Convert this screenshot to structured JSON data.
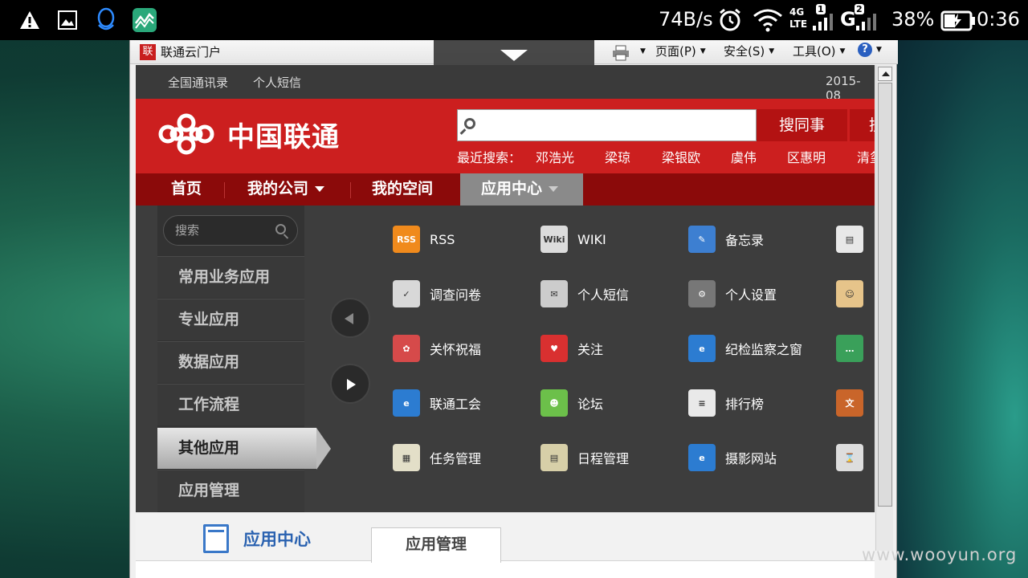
{
  "status_bar": {
    "net_speed": "74B/s",
    "net_type": "4G",
    "lte": "LTE",
    "sim1": "1",
    "sim2": "2",
    "g_label": "G",
    "battery": "38%",
    "time": "0:36"
  },
  "browser": {
    "tab_title": "联通云门户",
    "favicon_glyph": "联",
    "toolbar": {
      "page_label": "页面(P)",
      "safety_label": "安全(S)",
      "tools_label": "工具(O)",
      "help_icon": "?"
    }
  },
  "site": {
    "topbar": {
      "link1": "全国通讯录",
      "link2": "个人短信",
      "date": "2015-08"
    },
    "logo_text": "中国联通",
    "search": {
      "placeholder": "",
      "button": "搜同事",
      "button2": "搜"
    },
    "recent": {
      "label": "最近搜索：",
      "names": [
        "邓浩光",
        "梁琼",
        "梁银欧",
        "虞伟",
        "区惠明",
        "清玺"
      ]
    },
    "nav": {
      "home": "首页",
      "my_company": "我的公司",
      "my_space": "我的空间",
      "app_center": "应用中心"
    },
    "sidebar": {
      "search_label": "搜索",
      "items": [
        "常用业务应用",
        "专业应用",
        "数据应用",
        "工作流程",
        "其他应用",
        "应用管理"
      ],
      "active": "其他应用"
    },
    "apps": [
      {
        "label": "RSS",
        "icon": "rss-icon",
        "glyph": "RSS",
        "color": "#f08a1c"
      },
      {
        "label": "WIKI",
        "icon": "wiki-icon",
        "glyph": "Wiki",
        "color": "#dcdcdc"
      },
      {
        "label": "备忘录",
        "icon": "memo-icon",
        "glyph": "✎",
        "color": "#3d7fd1"
      },
      {
        "label": "",
        "icon": "printer-doc-icon",
        "glyph": "▤",
        "color": "#e8e8e8"
      },
      {
        "label": "调查问卷",
        "icon": "survey-icon",
        "glyph": "✓",
        "color": "#d8d8d8"
      },
      {
        "label": "个人短信",
        "icon": "sms-icon",
        "glyph": "✉",
        "color": "#ccc"
      },
      {
        "label": "个人设置",
        "icon": "gear-icon",
        "glyph": "⚙",
        "color": "#777"
      },
      {
        "label": "",
        "icon": "contact-card-icon",
        "glyph": "☺",
        "color": "#e6c48a"
      },
      {
        "label": "关怀祝福",
        "icon": "blessing-icon",
        "glyph": "✿",
        "color": "#d64a4a"
      },
      {
        "label": "关注",
        "icon": "follow-icon",
        "glyph": "♥",
        "color": "#d93030"
      },
      {
        "label": "纪检监察之窗",
        "icon": "ie-window-icon",
        "glyph": "e",
        "color": "#2c7cd1"
      },
      {
        "label": "",
        "icon": "chat-icon",
        "glyph": "…",
        "color": "#3aa05a"
      },
      {
        "label": "联通工会",
        "icon": "union-icon",
        "glyph": "e",
        "color": "#2c7cd1"
      },
      {
        "label": "论坛",
        "icon": "forum-icon",
        "glyph": "☻",
        "color": "#6cc04a"
      },
      {
        "label": "排行榜",
        "icon": "ranking-icon",
        "glyph": "≡",
        "color": "#e9e9e9"
      },
      {
        "label": "",
        "icon": "book-icon",
        "glyph": "文",
        "color": "#c9652a"
      },
      {
        "label": "任务管理",
        "icon": "task-icon",
        "glyph": "▦",
        "color": "#e3dfc8"
      },
      {
        "label": "日程管理",
        "icon": "calendar-icon",
        "glyph": "▤",
        "color": "#d7cfa8"
      },
      {
        "label": "摄影网站",
        "icon": "photo-ie-icon",
        "glyph": "e",
        "color": "#2c7cd1"
      },
      {
        "label": "",
        "icon": "hourglass-icon",
        "glyph": "⌛",
        "color": "#ddd"
      }
    ],
    "bottom": {
      "title": "应用中心",
      "tab": "应用管理"
    }
  },
  "watermark": "www.wooyun.org"
}
